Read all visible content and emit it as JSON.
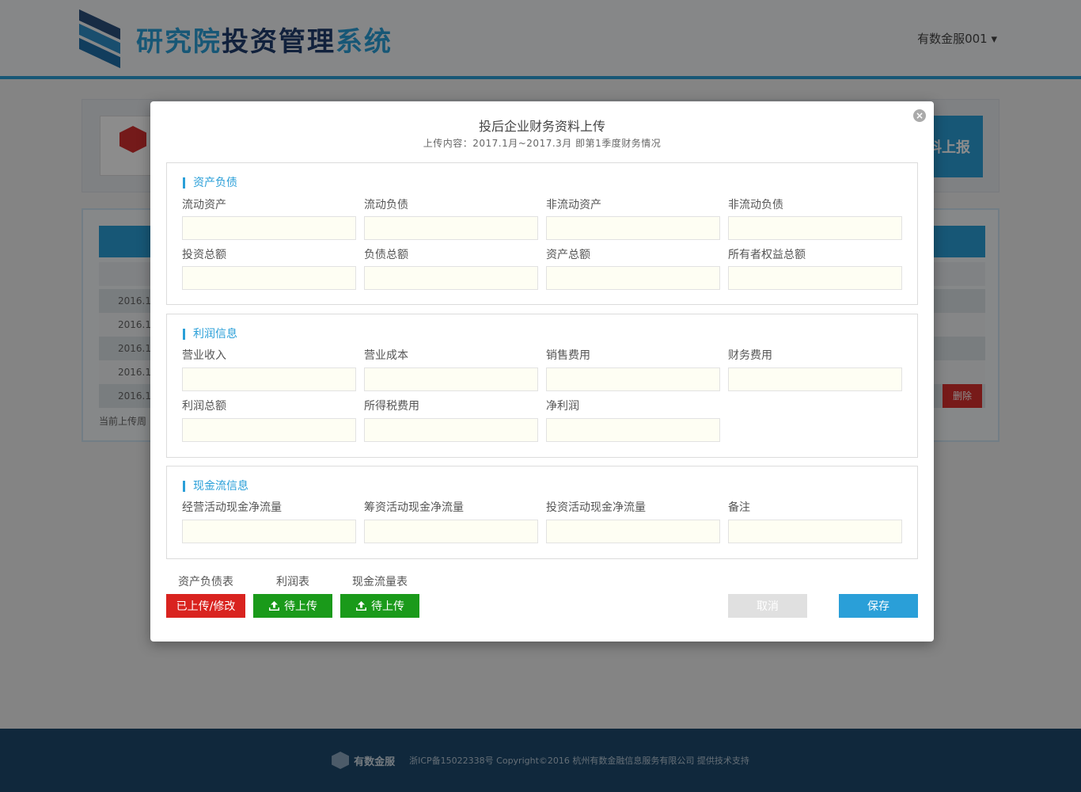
{
  "header": {
    "logo_text_part1": "研究院",
    "logo_text_part2": "投资管理",
    "logo_text_part3": "系统",
    "user_menu": "有数金服001 ▾"
  },
  "company_card": {
    "report_button": "料上报"
  },
  "table": {
    "rows": [
      "2016.1",
      "2016.1",
      "2016.1",
      "2016.1",
      "2016.1"
    ],
    "delete_button": "删除",
    "note": "当前上传周"
  },
  "footer": {
    "brand": "有数金服",
    "text": "浙ICP备15022338号 Copyright©2016 杭州有数金融信息服务有限公司 提供技术支持"
  },
  "modal": {
    "title": "投后企业财务资料上传",
    "subtitle": "上传内容：2017.1月~2017.3月 即第1季度财务情况",
    "close_symbol": "×",
    "sections": {
      "balance": {
        "title": "资产负债",
        "fields": [
          "流动资产",
          "流动负债",
          "非流动资产",
          "非流动负债",
          "投资总额",
          "负债总额",
          "资产总额",
          "所有者权益总额"
        ]
      },
      "profit": {
        "title": "利润信息",
        "fields": [
          "营业收入",
          "营业成本",
          "销售费用",
          "财务费用",
          "利润总额",
          "所得税费用",
          "净利润"
        ]
      },
      "cashflow": {
        "title": "现金流信息",
        "fields": [
          "经营活动现金净流量",
          "筹资活动现金净流量",
          "投资活动现金净流量",
          "备注"
        ]
      }
    },
    "uploads": [
      {
        "label": "资产负债表",
        "button": "已上传/修改",
        "status": "uploaded"
      },
      {
        "label": "利润表",
        "button": "待上传",
        "status": "pending"
      },
      {
        "label": "现金流量表",
        "button": "待上传",
        "status": "pending"
      }
    ],
    "cancel_button": "取消",
    "save_button": "保存"
  },
  "colors": {
    "accent": "#2a9fd8",
    "uploaded": "#d9231f",
    "pending": "#1a9a1a",
    "input_bg": "#fefef3"
  }
}
